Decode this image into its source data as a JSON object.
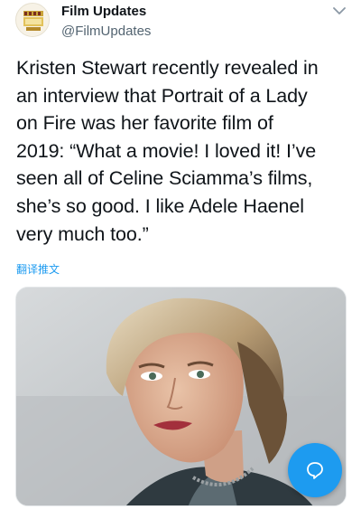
{
  "account": {
    "display_name": "Film Updates",
    "handle": "@FilmUpdates",
    "avatar_icon": "film-updates-logo-icon"
  },
  "header": {
    "more_icon": "chevron-down-icon"
  },
  "tweet": {
    "lines": [
      "Kristen Stewart recently revealed in",
      "an interview that Portrait of a Lady",
      "on Fire was her favorite film of",
      "2019: “What a movie! I loved it! I’ve",
      "seen all of Celine Sciamma’s films,",
      "she’s so good. I like Adele Haenel",
      "very much too.”"
    ],
    "translate_label": "翻译推文"
  },
  "media": {
    "description_icon": "photo-image"
  },
  "fab": {
    "icon": "speech-bubble-icon",
    "color": "#1d9bf0"
  }
}
